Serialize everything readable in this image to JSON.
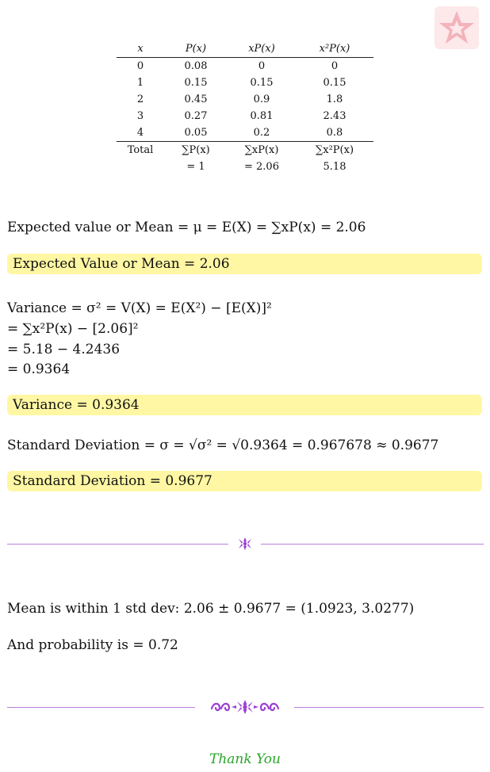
{
  "table": {
    "headers": [
      "x",
      "P(x)",
      "xP(x)",
      "x²P(x)"
    ],
    "rows": [
      [
        "0",
        "0.08",
        "0",
        "0"
      ],
      [
        "1",
        "0.15",
        "0.15",
        "0.15"
      ],
      [
        "2",
        "0.45",
        "0.9",
        "1.8"
      ],
      [
        "3",
        "0.27",
        "0.81",
        "2.43"
      ],
      [
        "4",
        "0.05",
        "0.2",
        "0.8"
      ]
    ],
    "total_row": [
      "Total",
      "∑P(x)",
      "∑xP(x)",
      "∑x²P(x)"
    ],
    "sum_row": [
      "",
      "= 1",
      "= 2.06",
      "5.18"
    ]
  },
  "mean": {
    "formula": "Expected value or Mean = μ = E(X) = ∑xP(x) = 2.06",
    "result": "Expected Value or Mean = 2.06"
  },
  "variance": {
    "line1": "Variance = σ² = V(X) = E(X²) − [E(X)]²",
    "line2": "= ∑x²P(x) − [2.06]²",
    "line3": "= 5.18 − 4.2436",
    "line4": "= 0.9364",
    "result": "Variance = 0.9364"
  },
  "std": {
    "formula": "Standard Deviation = σ = √σ² = √0.9364 = 0.967678 ≈ 0.9677",
    "result": "Standard Deviation = 0.9677"
  },
  "within": {
    "line": "Mean is within 1 std dev: 2.06 ± 0.9677 = (1.0923, 3.0277)",
    "probability": "And probability is = 0.72"
  },
  "closing": "Thank You",
  "colors": {
    "highlight": "#fff7a3",
    "divider": "#b87fdc",
    "ornament": "#9b3fd1",
    "thanks": "#2aa52a",
    "logo": "#f3b3ba"
  }
}
